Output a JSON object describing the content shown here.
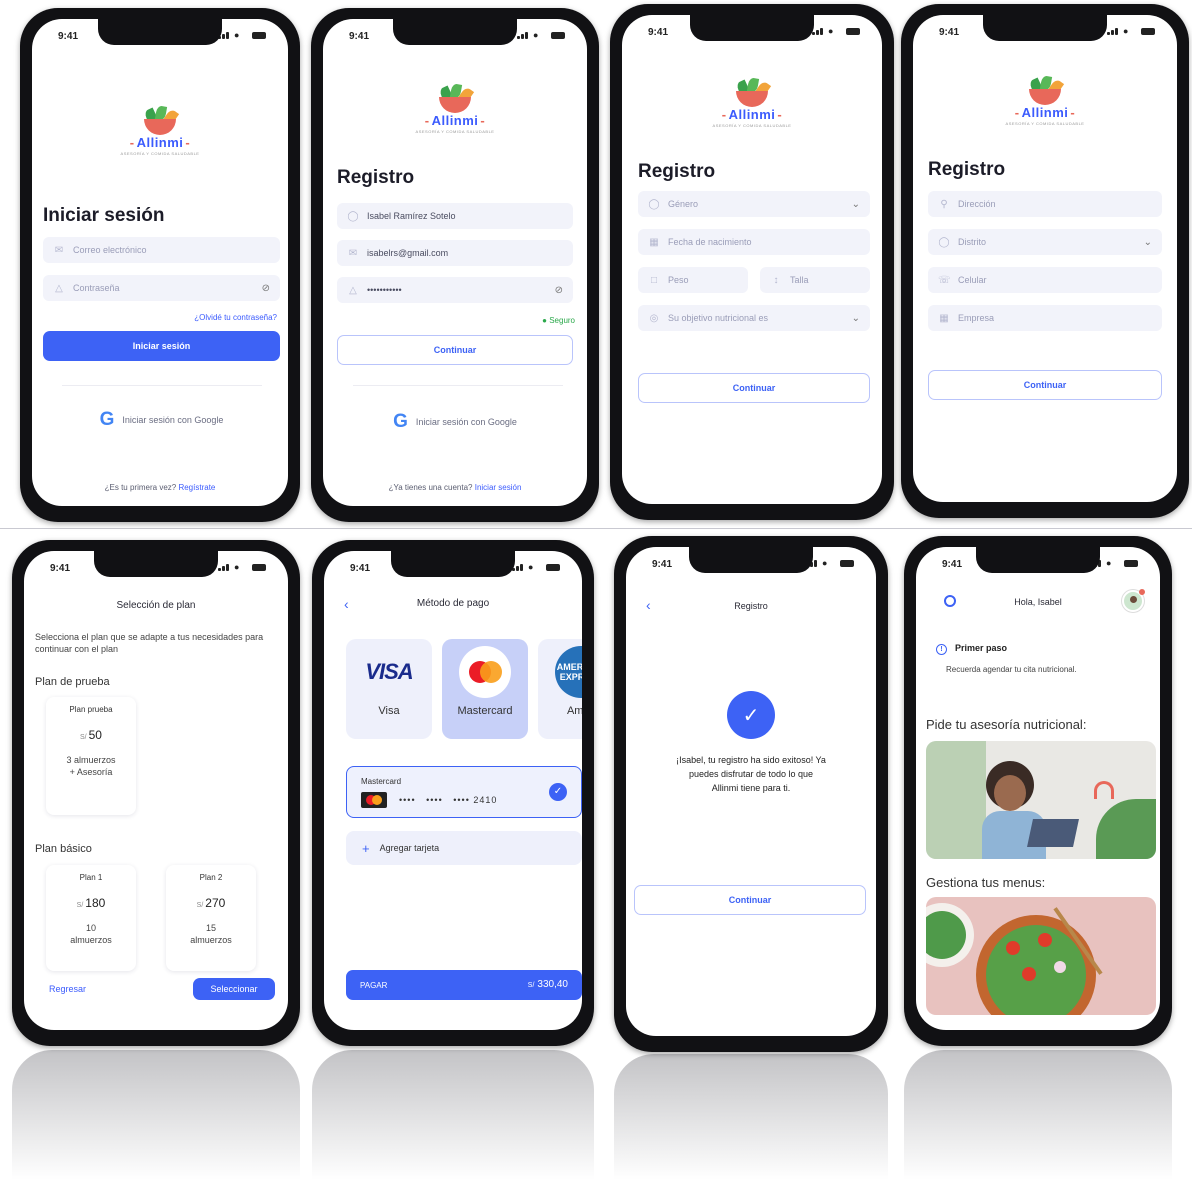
{
  "status": {
    "time": "9:41"
  },
  "brand": {
    "name": "Allinmi",
    "tagline": "ASESORÍA Y COMIDA SALUDABLE"
  },
  "login": {
    "title": "Iniciar sesión",
    "email_placeholder": "Correo electrónico",
    "password_placeholder": "Contraseña",
    "forgot": "¿Olvidé tu contraseña?",
    "submit": "Iniciar sesión",
    "google": "Iniciar sesión con Google",
    "first_time": "¿Es tu primera vez?",
    "register_link": "Regístrate"
  },
  "register1": {
    "title": "Registro",
    "name_value": "Isabel Ramírez Sotelo",
    "email_value": "isabelrs@gmail.com",
    "password_value": "•••••••••••",
    "strength": "Seguro",
    "continue": "Continuar",
    "google": "Iniciar sesión con Google",
    "have_account": "¿Ya tienes una cuenta?",
    "login_link": "Iniciar sesión"
  },
  "register2": {
    "title": "Registro",
    "gender_placeholder": "Género",
    "birth_placeholder": "Fecha de nacimiento",
    "weight_placeholder": "Peso",
    "height_placeholder": "Talla",
    "goal_placeholder": "Su objetivo nutricional es",
    "continue": "Continuar"
  },
  "register3": {
    "title": "Registro",
    "address_placeholder": "Dirección",
    "district_placeholder": "Distrito",
    "phone_placeholder": "Celular",
    "company_placeholder": "Empresa",
    "continue": "Continuar"
  },
  "plans": {
    "title": "Selección de plan",
    "intro": "Selecciona el plan que se adapte a tus necesidades para continuar con el plan",
    "trial_section": "Plan de prueba",
    "trial": {
      "name": "Plan prueba",
      "currency": "S/",
      "price": "50",
      "desc1": "3 almuerzos",
      "desc2": "+ Asesoría"
    },
    "basic_section": "Plan básico",
    "plan1": {
      "name": "Plan 1",
      "currency": "S/",
      "price": "180",
      "desc1": "10",
      "desc2": "almuerzos"
    },
    "plan2": {
      "name": "Plan 2",
      "currency": "S/",
      "price": "270",
      "desc1": "15",
      "desc2": "almuerzos"
    },
    "back": "Regresar",
    "select": "Seleccionar"
  },
  "payment": {
    "title": "Método de pago",
    "methods": [
      {
        "logo": "VISA",
        "label": "Visa"
      },
      {
        "logo": "",
        "label": "Mastercard"
      },
      {
        "logo": "AMERICAN EXPRESS",
        "label": "Amex"
      }
    ],
    "card_brand": "Mastercard",
    "card_masked1": "••••",
    "card_masked2": "••••",
    "card_masked3": "••••",
    "card_last4": "2410",
    "add_card": "Agregar tarjeta",
    "pay_label": "PAGAR",
    "pay_currency": "S/",
    "pay_amount": "330,40"
  },
  "success": {
    "title": "Registro",
    "message": "¡Isabel, tu registro ha sido exitoso! Ya puedes disfrutar de todo lo que Allinmi tiene para ti.",
    "continue": "Continuar"
  },
  "home": {
    "greeting": "Hola, Isabel",
    "step_title": "Primer paso",
    "step_text": "Recuerda agendar tu cita nutricional.",
    "section1": "Pide tu asesoría nutricional:",
    "section2": "Gestiona tus menus:"
  },
  "colors": {
    "accent": "#3d62f5",
    "brand_red": "#e8685a",
    "field_bg": "#f2f3fa"
  },
  "icons": [
    "search-icon",
    "chevron-left-icon",
    "eye-off-icon",
    "check-icon",
    "plus-icon",
    "info-icon",
    "user-icon",
    "mail-icon",
    "lock-icon",
    "google-icon"
  ]
}
